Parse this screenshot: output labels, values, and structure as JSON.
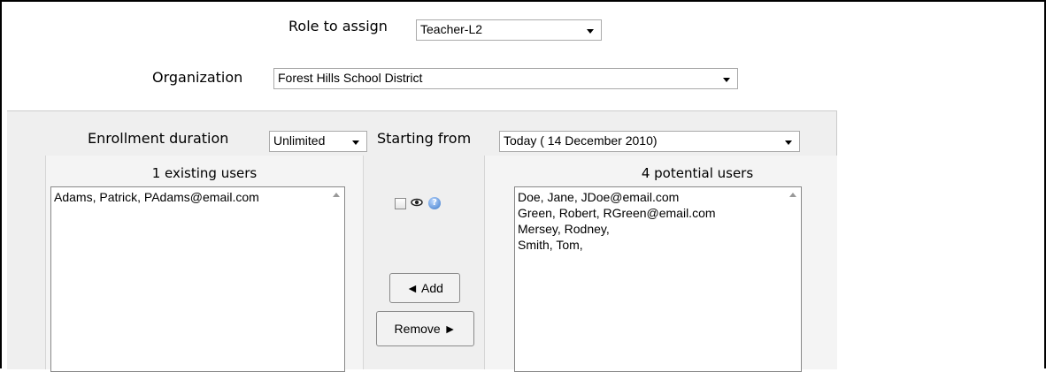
{
  "role": {
    "label": "Role to assign",
    "selected": "Teacher-L2"
  },
  "organization": {
    "label": "Organization",
    "selected": "Forest Hills School District"
  },
  "enrollment": {
    "duration_label": "Enrollment duration",
    "duration_selected": "Unlimited",
    "starting_label": "Starting from",
    "starting_selected": "Today ( 14 December 2010)"
  },
  "existing": {
    "heading": "1 existing users",
    "users": [
      "Adams, Patrick, PAdams@email.com"
    ]
  },
  "potential": {
    "heading": "4 potential users",
    "users": [
      "Doe, Jane, JDoe@email.com",
      "Green, Robert, RGreen@email.com",
      "Mersey, Rodney,",
      "Smith, Tom,"
    ]
  },
  "buttons": {
    "add": "◄ Add",
    "remove": "Remove ►"
  },
  "icons": [
    "checkbox-icon",
    "eye-icon",
    "help-icon"
  ]
}
